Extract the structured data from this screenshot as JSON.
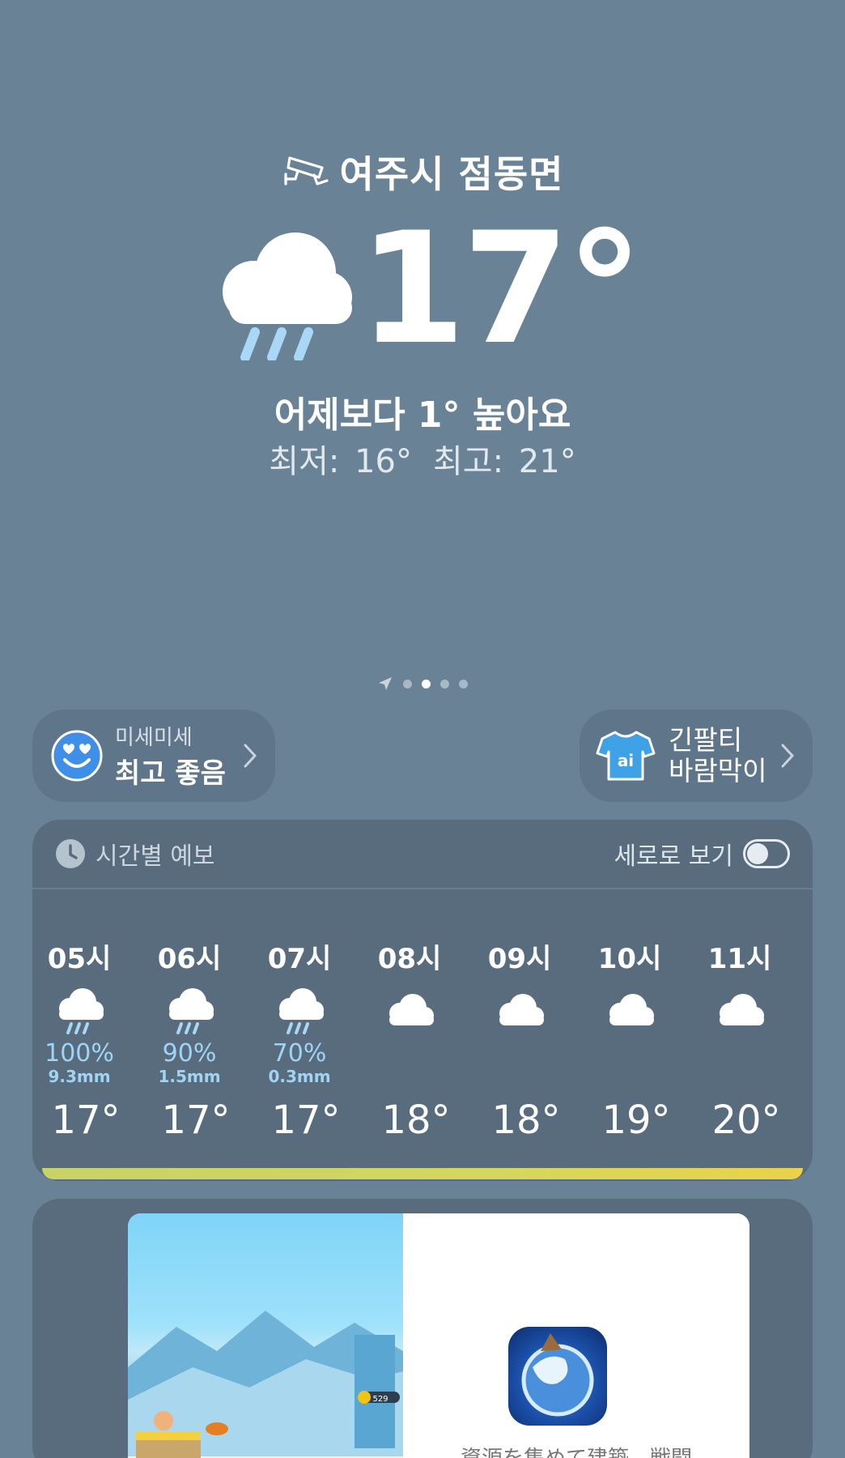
{
  "header": {
    "location": "여주시 점동면",
    "current_temp": "17°",
    "summary": "어제보다 1° 높아요",
    "low": "최저: 16°",
    "high": "최고: 21°"
  },
  "pager": {
    "count": 4,
    "active_index": 1
  },
  "dust_pill": {
    "label": "미세미세",
    "value": "최고 좋음"
  },
  "outfit_pill": {
    "line1": "긴팔티",
    "line2": "바람막이"
  },
  "hourly": {
    "title": "시간별 예보",
    "vertical_view_label": "세로로 보기",
    "vertical_view_enabled": false,
    "hours": [
      {
        "time": "05시",
        "icon": "rain-cloud-icon",
        "precip_prob": "100%",
        "precip_mm": "9.3mm",
        "temp": "17°"
      },
      {
        "time": "06시",
        "icon": "rain-cloud-icon",
        "precip_prob": "90%",
        "precip_mm": "1.5mm",
        "temp": "17°"
      },
      {
        "time": "07시",
        "icon": "rain-cloud-icon",
        "precip_prob": "70%",
        "precip_mm": "0.3mm",
        "temp": "17°"
      },
      {
        "time": "08시",
        "icon": "cloud-icon",
        "precip_prob": "",
        "precip_mm": "",
        "temp": "18°"
      },
      {
        "time": "09시",
        "icon": "cloud-icon",
        "precip_prob": "",
        "precip_mm": "",
        "temp": "18°"
      },
      {
        "time": "10시",
        "icon": "cloud-icon",
        "precip_prob": "",
        "precip_mm": "",
        "temp": "19°"
      },
      {
        "time": "11시",
        "icon": "cloud-icon",
        "precip_prob": "",
        "precip_mm": "",
        "temp": "20°"
      }
    ]
  },
  "ad": {
    "text": "資源を集めて建築、戦闘",
    "coin_count": "529"
  },
  "colors": {
    "background": "#6a8296",
    "card": "#586c7e",
    "precip_text": "#9fd4f5",
    "temp_bar_start": "#c7d267",
    "temp_bar_end": "#ead24a"
  }
}
